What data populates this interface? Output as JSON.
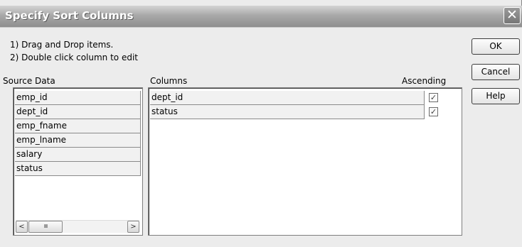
{
  "window": {
    "title": "Specify Sort Columns",
    "close_symbol": "✕"
  },
  "instructions": [
    "1) Drag and Drop items.",
    "2) Double click column to edit"
  ],
  "source_panel": {
    "label": "Source Data",
    "items": [
      "emp_id",
      "dept_id",
      "emp_fname",
      "emp_lname",
      "salary",
      "status"
    ]
  },
  "columns_panel": {
    "label": "Columns",
    "ascending_label": "Ascending",
    "rows": [
      {
        "name": "dept_id",
        "ascending": true
      },
      {
        "name": "status",
        "ascending": true
      }
    ]
  },
  "buttons": {
    "ok": "OK",
    "cancel": "Cancel",
    "help": "Help"
  },
  "scrollbar": {
    "left_arrow": "<",
    "right_arrow": ">",
    "grip": "IIIII"
  },
  "check_mark": "✓"
}
